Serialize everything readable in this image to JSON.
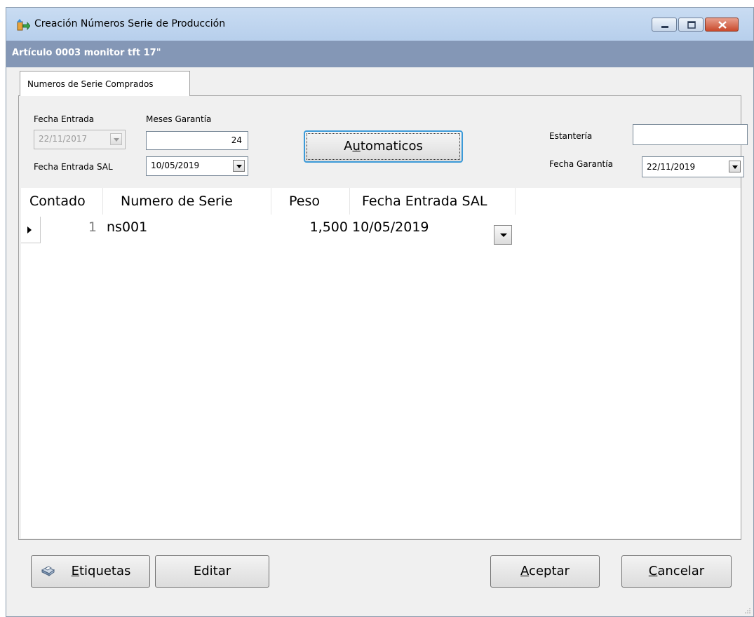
{
  "window": {
    "title": "Creación Números Serie de Producción",
    "controls": [
      "minimize",
      "maximize",
      "close"
    ]
  },
  "header": {
    "text": "Artículo 0003 monitor tft 17\""
  },
  "tab": {
    "label": "Numeros de Serie Comprados"
  },
  "form": {
    "fecha_entrada_label": "Fecha Entrada",
    "fecha_entrada_value": "22/11/2017",
    "meses_garantia_label": "Meses Garantía",
    "meses_garantia_value": "24",
    "fecha_entrada_sal_label": "Fecha Entrada SAL",
    "fecha_entrada_sal_value": "10/05/2019",
    "automaticos_pre": "A",
    "automaticos_mnemonic": "u",
    "automaticos_post": "tomaticos",
    "estanteria_label": "Estantería",
    "estanteria_value": "",
    "fecha_garantia_label": "Fecha Garantía",
    "fecha_garantia_value": "22/11/2019"
  },
  "grid": {
    "columns": [
      "Contado",
      "Numero de Serie",
      "Peso",
      "Fecha Entrada SAL"
    ],
    "rows": [
      {
        "contado": "1",
        "numero_serie": "ns001",
        "peso": "1,500",
        "fecha_entrada_sal": "10/05/2019"
      }
    ]
  },
  "buttons": {
    "etiquetas_mnemonic": "E",
    "etiquetas_rest": "tiquetas",
    "editar": "Editar",
    "aceptar_mnemonic": "A",
    "aceptar_rest": "ceptar",
    "cancelar_mnemonic": "C",
    "cancelar_rest": "ancelar"
  },
  "colors": {
    "titlebar": "#c9dcf2",
    "header_band": "#8497b6",
    "focus_border": "#3c9ad8",
    "close_button": "#c94a2c"
  }
}
